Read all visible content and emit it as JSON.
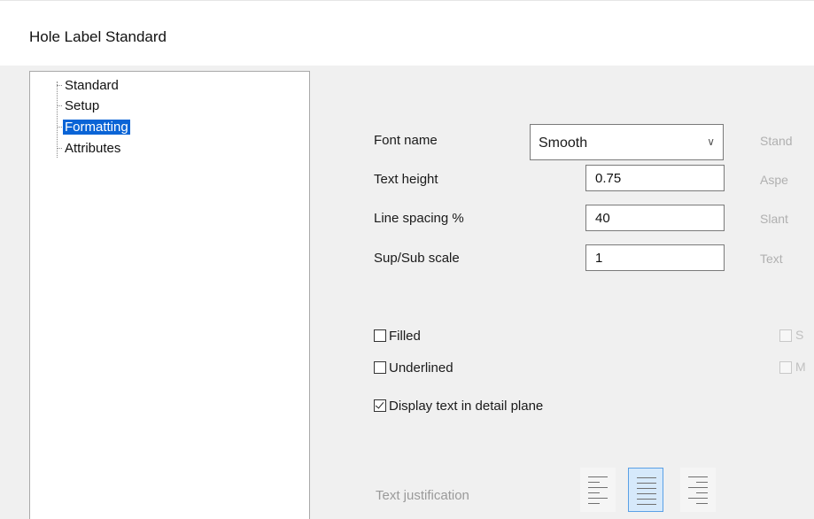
{
  "window": {
    "title": "Hole Label Standard"
  },
  "tree": {
    "items": [
      {
        "label": "Standard",
        "selected": false
      },
      {
        "label": "Setup",
        "selected": false
      },
      {
        "label": "Formatting",
        "selected": true
      },
      {
        "label": "Attributes",
        "selected": false
      }
    ]
  },
  "formatting": {
    "font_name_label": "Font name",
    "font_name_value": "Smooth",
    "text_height_label": "Text height",
    "text_height_value": "0.75",
    "line_spacing_label": "Line spacing %",
    "line_spacing_value": "40",
    "supsub_label": "Sup/Sub scale",
    "supsub_value": "1",
    "filled_label": "Filled",
    "filled_checked": false,
    "underlined_label": "Underlined",
    "underlined_checked": false,
    "detail_plane_label": "Display text in detail plane",
    "detail_plane_checked": true,
    "justification_label": "Text justification",
    "justification_selected": "center"
  },
  "right_panel": {
    "labels": [
      "Stand",
      "Aspe",
      "Slant",
      "Text"
    ]
  },
  "colors": {
    "selection": "#0a64d6",
    "panel_bg": "#f0f0f0"
  }
}
